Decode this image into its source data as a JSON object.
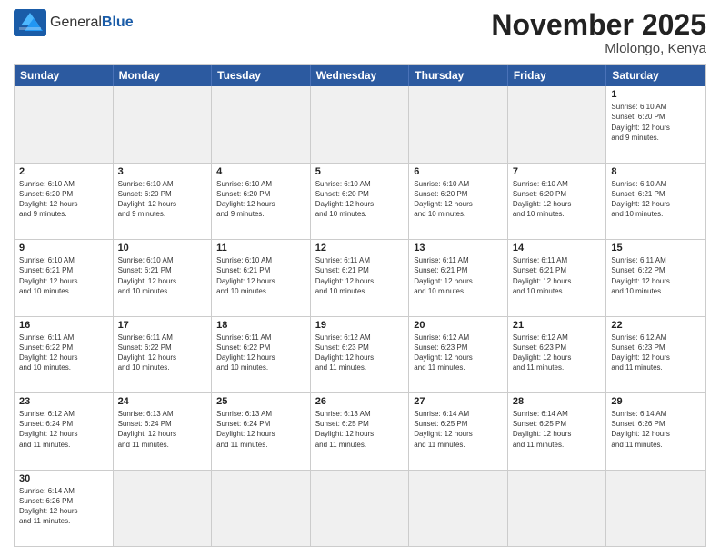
{
  "header": {
    "logo_general": "General",
    "logo_blue": "Blue",
    "month_title": "November 2025",
    "subtitle": "Mlolongo, Kenya"
  },
  "weekdays": [
    "Sunday",
    "Monday",
    "Tuesday",
    "Wednesday",
    "Thursday",
    "Friday",
    "Saturday"
  ],
  "rows": [
    [
      {
        "day": "",
        "detail": "",
        "empty": true
      },
      {
        "day": "",
        "detail": "",
        "empty": true
      },
      {
        "day": "",
        "detail": "",
        "empty": true
      },
      {
        "day": "",
        "detail": "",
        "empty": true
      },
      {
        "day": "",
        "detail": "",
        "empty": true
      },
      {
        "day": "",
        "detail": "",
        "empty": true
      },
      {
        "day": "1",
        "detail": "Sunrise: 6:10 AM\nSunset: 6:20 PM\nDaylight: 12 hours\nand 9 minutes.",
        "empty": false
      }
    ],
    [
      {
        "day": "2",
        "detail": "Sunrise: 6:10 AM\nSunset: 6:20 PM\nDaylight: 12 hours\nand 9 minutes.",
        "empty": false
      },
      {
        "day": "3",
        "detail": "Sunrise: 6:10 AM\nSunset: 6:20 PM\nDaylight: 12 hours\nand 9 minutes.",
        "empty": false
      },
      {
        "day": "4",
        "detail": "Sunrise: 6:10 AM\nSunset: 6:20 PM\nDaylight: 12 hours\nand 9 minutes.",
        "empty": false
      },
      {
        "day": "5",
        "detail": "Sunrise: 6:10 AM\nSunset: 6:20 PM\nDaylight: 12 hours\nand 10 minutes.",
        "empty": false
      },
      {
        "day": "6",
        "detail": "Sunrise: 6:10 AM\nSunset: 6:20 PM\nDaylight: 12 hours\nand 10 minutes.",
        "empty": false
      },
      {
        "day": "7",
        "detail": "Sunrise: 6:10 AM\nSunset: 6:20 PM\nDaylight: 12 hours\nand 10 minutes.",
        "empty": false
      },
      {
        "day": "8",
        "detail": "Sunrise: 6:10 AM\nSunset: 6:21 PM\nDaylight: 12 hours\nand 10 minutes.",
        "empty": false
      }
    ],
    [
      {
        "day": "9",
        "detail": "Sunrise: 6:10 AM\nSunset: 6:21 PM\nDaylight: 12 hours\nand 10 minutes.",
        "empty": false
      },
      {
        "day": "10",
        "detail": "Sunrise: 6:10 AM\nSunset: 6:21 PM\nDaylight: 12 hours\nand 10 minutes.",
        "empty": false
      },
      {
        "day": "11",
        "detail": "Sunrise: 6:10 AM\nSunset: 6:21 PM\nDaylight: 12 hours\nand 10 minutes.",
        "empty": false
      },
      {
        "day": "12",
        "detail": "Sunrise: 6:11 AM\nSunset: 6:21 PM\nDaylight: 12 hours\nand 10 minutes.",
        "empty": false
      },
      {
        "day": "13",
        "detail": "Sunrise: 6:11 AM\nSunset: 6:21 PM\nDaylight: 12 hours\nand 10 minutes.",
        "empty": false
      },
      {
        "day": "14",
        "detail": "Sunrise: 6:11 AM\nSunset: 6:21 PM\nDaylight: 12 hours\nand 10 minutes.",
        "empty": false
      },
      {
        "day": "15",
        "detail": "Sunrise: 6:11 AM\nSunset: 6:22 PM\nDaylight: 12 hours\nand 10 minutes.",
        "empty": false
      }
    ],
    [
      {
        "day": "16",
        "detail": "Sunrise: 6:11 AM\nSunset: 6:22 PM\nDaylight: 12 hours\nand 10 minutes.",
        "empty": false
      },
      {
        "day": "17",
        "detail": "Sunrise: 6:11 AM\nSunset: 6:22 PM\nDaylight: 12 hours\nand 10 minutes.",
        "empty": false
      },
      {
        "day": "18",
        "detail": "Sunrise: 6:11 AM\nSunset: 6:22 PM\nDaylight: 12 hours\nand 10 minutes.",
        "empty": false
      },
      {
        "day": "19",
        "detail": "Sunrise: 6:12 AM\nSunset: 6:23 PM\nDaylight: 12 hours\nand 11 minutes.",
        "empty": false
      },
      {
        "day": "20",
        "detail": "Sunrise: 6:12 AM\nSunset: 6:23 PM\nDaylight: 12 hours\nand 11 minutes.",
        "empty": false
      },
      {
        "day": "21",
        "detail": "Sunrise: 6:12 AM\nSunset: 6:23 PM\nDaylight: 12 hours\nand 11 minutes.",
        "empty": false
      },
      {
        "day": "22",
        "detail": "Sunrise: 6:12 AM\nSunset: 6:23 PM\nDaylight: 12 hours\nand 11 minutes.",
        "empty": false
      }
    ],
    [
      {
        "day": "23",
        "detail": "Sunrise: 6:12 AM\nSunset: 6:24 PM\nDaylight: 12 hours\nand 11 minutes.",
        "empty": false
      },
      {
        "day": "24",
        "detail": "Sunrise: 6:13 AM\nSunset: 6:24 PM\nDaylight: 12 hours\nand 11 minutes.",
        "empty": false
      },
      {
        "day": "25",
        "detail": "Sunrise: 6:13 AM\nSunset: 6:24 PM\nDaylight: 12 hours\nand 11 minutes.",
        "empty": false
      },
      {
        "day": "26",
        "detail": "Sunrise: 6:13 AM\nSunset: 6:25 PM\nDaylight: 12 hours\nand 11 minutes.",
        "empty": false
      },
      {
        "day": "27",
        "detail": "Sunrise: 6:14 AM\nSunset: 6:25 PM\nDaylight: 12 hours\nand 11 minutes.",
        "empty": false
      },
      {
        "day": "28",
        "detail": "Sunrise: 6:14 AM\nSunset: 6:25 PM\nDaylight: 12 hours\nand 11 minutes.",
        "empty": false
      },
      {
        "day": "29",
        "detail": "Sunrise: 6:14 AM\nSunset: 6:26 PM\nDaylight: 12 hours\nand 11 minutes.",
        "empty": false
      }
    ],
    [
      {
        "day": "30",
        "detail": "Sunrise: 6:14 AM\nSunset: 6:26 PM\nDaylight: 12 hours\nand 11 minutes.",
        "empty": false
      },
      {
        "day": "",
        "detail": "",
        "empty": true
      },
      {
        "day": "",
        "detail": "",
        "empty": true
      },
      {
        "day": "",
        "detail": "",
        "empty": true
      },
      {
        "day": "",
        "detail": "",
        "empty": true
      },
      {
        "day": "",
        "detail": "",
        "empty": true
      },
      {
        "day": "",
        "detail": "",
        "empty": true
      }
    ]
  ]
}
